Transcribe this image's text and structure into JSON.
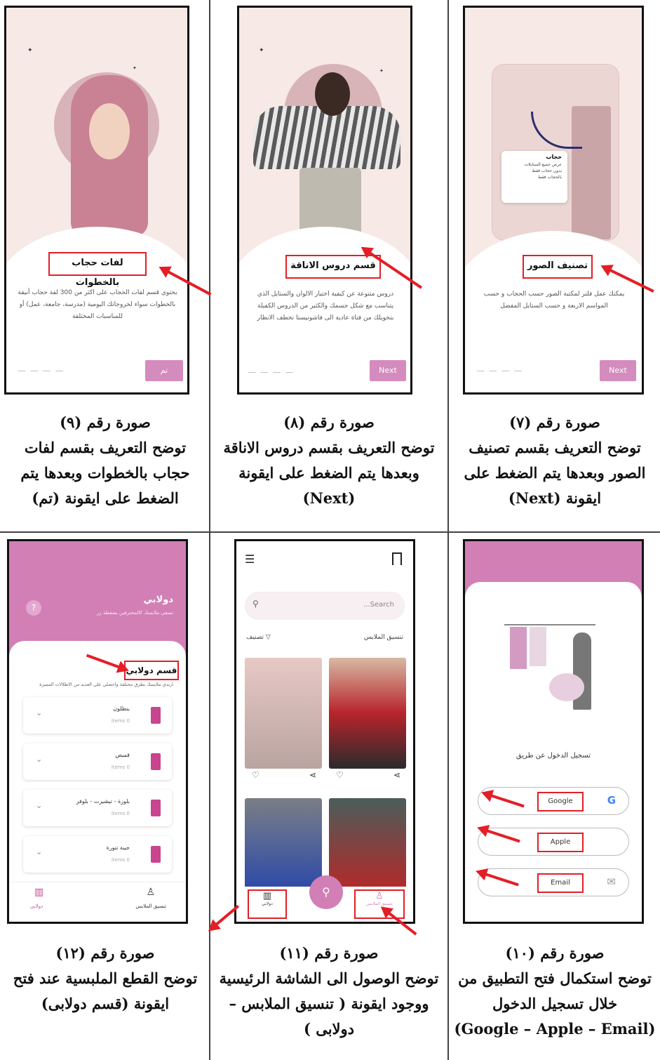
{
  "cells": {
    "fig9": {
      "title": "لفات حجاب بالخطوات",
      "desc": "يحتوي قسم لفات الحجاب على اكثر من 300 لفة حجاب أنيقة بالخطوات سواء لخروجاتك اليومية (مدرسة، جامعة، عمل) أو للمناسبات المختلفة",
      "button": "تم",
      "caption_line1": "صورة رقم (٩)",
      "caption_line2": "توضح التعريف بقسم لفات",
      "caption_line3": "حجاب بالخطوات وبعدها يتم",
      "caption_line4": "الضغط على ايقونة (تم)"
    },
    "fig8": {
      "title": "قسم دروس الاناقة",
      "desc": "دروس متنوعة عن كيفية اختيار الالوان والستايل الذي يتناسب مع شكل جسمك والكثير من الدروس الكفيلة بتحويلك من فتاة عادية الى فاشونيستا تخطف الانظار",
      "button": "Next",
      "caption_line1": "صورة رقم (٨)",
      "caption_line2": "توضح التعريف بقسم دروس الاناقة",
      "caption_line3": "وبعدها يتم الضغط على ايقونة",
      "caption_line4": "(Next)"
    },
    "fig7": {
      "title": "تصنيف الصور",
      "desc": "يمكنك عمل فلتر لمكتبة الصور حسب الحجاب و حسب المواسم الاربعة و حسب الستايل المفضل",
      "button": "Next",
      "popup_title": "حجاب",
      "popup_options": [
        "عرض جميع الستايلات",
        "بدون حجاب فقط",
        "بالحجاب فقط"
      ],
      "caption_line1": "صورة رقم (٧)",
      "caption_line2": "توضح التعريف بقسم تصنيف",
      "caption_line3": "الصور وبعدها يتم الضغط على",
      "caption_line4": "ايقونة (Next)"
    },
    "fig12": {
      "app_title": "دولابي",
      "app_subtitle": "نسقي ملابسك كالمحترفين بضغطة زر",
      "section_title": "قسم دولابي",
      "section_desc": "ارتدي ملابسك بطرق مختلفة واحصلي على العديد من الاطلالات المميزة",
      "items": [
        {
          "name": "بنطلون",
          "count": "items 0"
        },
        {
          "name": "قميص",
          "count": "items 0"
        },
        {
          "name": "بلوزة - تيشيرت - بلوفر",
          "count": "items 0"
        },
        {
          "name": "جيبة تنورة",
          "count": "items 0"
        }
      ],
      "nav_left": "دولابي",
      "nav_right": "تنسيق الملابس",
      "caption_line1": "صورة رقم (١٢)",
      "caption_line2": "توضح القطع الملبسية عند فتح",
      "caption_line3": "ايقونة (قسم دولابى)"
    },
    "fig11": {
      "search_placeholder": "...Search",
      "filter_label": "تصنيف",
      "section_label": "تنسيق الملابس",
      "nav_left": "دولابي",
      "nav_right": "تنسيق الملابس",
      "caption_line1": "صورة رقم (١١)",
      "caption_line2": "توضح الوصول الى الشاشة الرئيسية",
      "caption_line3": "ووجود ايقونة ( تنسيق الملابس –",
      "caption_line4": "دولابى )"
    },
    "fig10": {
      "login_label": "تسجيل الدخول عن طريق",
      "google": "Google",
      "apple": "Apple",
      "email": "Email",
      "caption_line1": "صورة رقم (١٠)",
      "caption_line2": "توضح استكمال فتح التطبيق من",
      "caption_line3": "خلال تسجيل الدخول",
      "caption_line4": "(Google – Apple – Email)"
    }
  },
  "colors": {
    "accent": "#d48bbd",
    "brand": "#c9458f",
    "annotation": "#e41e26"
  }
}
